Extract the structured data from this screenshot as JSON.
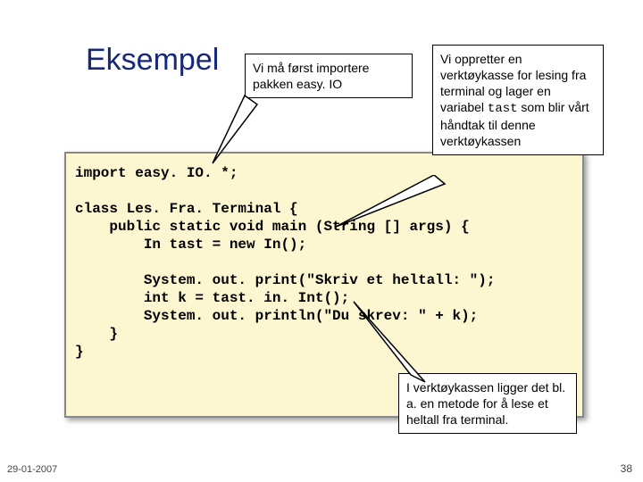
{
  "title": "Eksempel",
  "callouts": {
    "c1": "Vi må først importere pakken easy. IO",
    "c2_pre": "Vi oppretter en verktøykasse for lesing fra terminal og lager en variabel ",
    "c2_code": "tast",
    "c2_post": " som blir vårt håndtak til denne verktøykassen",
    "c3": "I verktøykassen ligger det bl. a. en metode for å lese et heltall fra terminal."
  },
  "code": "import easy. IO. *;\n\nclass Les. Fra. Terminal {\n    public static void main (String [] args) {\n        In tast = new In();\n\n        System. out. print(\"Skriv et heltall: \");\n        int k = tast. in. Int();\n        System. out. println(\"Du skrev: \" + k);\n    }\n}",
  "footer": {
    "date": "29-01-2007",
    "page": "38"
  }
}
